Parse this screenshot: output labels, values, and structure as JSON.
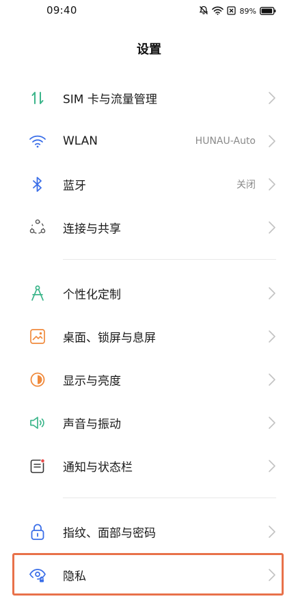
{
  "status_bar": {
    "time": "09:40",
    "battery_percent": "89%",
    "icons": [
      "mute-icon",
      "wifi-icon",
      "sim-off-icon",
      "battery-icon"
    ]
  },
  "header": {
    "title": "设置"
  },
  "settings": {
    "items": [
      {
        "label": "SIM 卡与流量管理",
        "value": "",
        "icon": "sim-data-icon"
      },
      {
        "label": "WLAN",
        "value": "HUNAU-Auto",
        "icon": "wifi-icon"
      },
      {
        "label": "蓝牙",
        "value": "关闭",
        "icon": "bluetooth-icon"
      },
      {
        "label": "连接与共享",
        "value": "",
        "icon": "connection-share-icon"
      },
      {
        "label": "个性化定制",
        "value": "",
        "icon": "compass-icon"
      },
      {
        "label": "桌面、锁屏与息屏",
        "value": "",
        "icon": "wallpaper-icon"
      },
      {
        "label": "显示与亮度",
        "value": "",
        "icon": "brightness-icon"
      },
      {
        "label": "声音与振动",
        "value": "",
        "icon": "sound-icon"
      },
      {
        "label": "通知与状态栏",
        "value": "",
        "icon": "notification-icon"
      },
      {
        "label": "指纹、面部与密码",
        "value": "",
        "icon": "lock-icon"
      },
      {
        "label": "隐私",
        "value": "",
        "icon": "privacy-eye-icon"
      }
    ]
  },
  "colors": {
    "highlight": "#e8714a",
    "green": "#3bb58a",
    "blue": "#3a6ee8",
    "orange": "#f08a3c",
    "red": "#e84a4a"
  }
}
